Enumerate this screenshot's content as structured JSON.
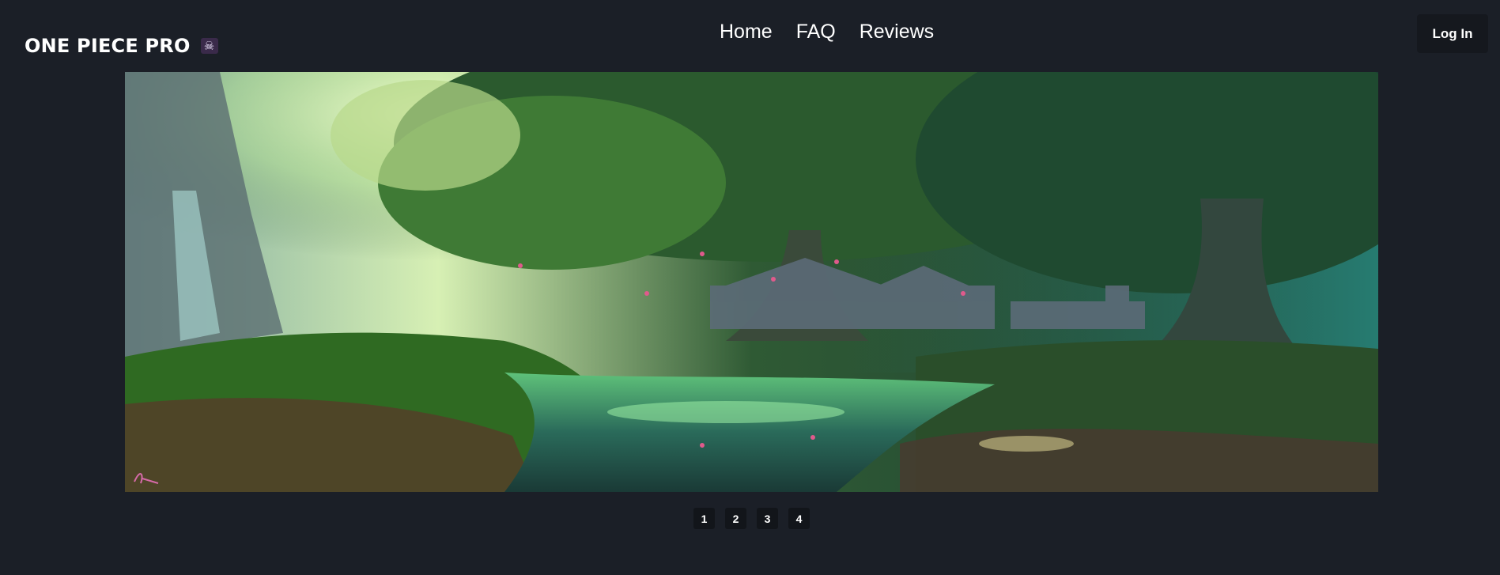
{
  "brand": {
    "name": "ONE PIECE PRO",
    "icon": "skull-crossbones-icon"
  },
  "nav": {
    "items": [
      "Home",
      "FAQ",
      "Reviews"
    ]
  },
  "header": {
    "login_label": "Log In"
  },
  "hero": {
    "artist_signature": "signature"
  },
  "pagination": {
    "pages": [
      "1",
      "2",
      "3",
      "4"
    ],
    "current": "1"
  }
}
